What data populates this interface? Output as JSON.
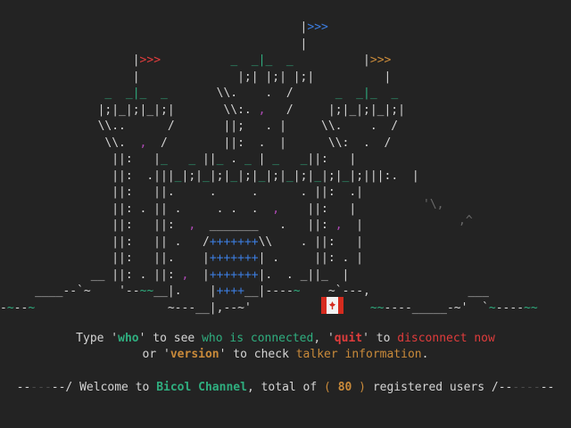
{
  "castle_rows": [
    {
      "segs": [
        [
          "                                           ",
          "w"
        ],
        [
          "|",
          "w"
        ],
        [
          ">>>",
          "b"
        ]
      ]
    },
    {
      "segs": [
        [
          "                                           |",
          "w"
        ]
      ]
    },
    {
      "segs": [
        [
          "                   ",
          "w"
        ],
        [
          "|",
          "w"
        ],
        [
          ">>>",
          "r"
        ],
        [
          "          ",
          "w"
        ],
        [
          "_  _|_  _",
          "g"
        ],
        [
          "          ",
          "w"
        ],
        [
          "|",
          "w"
        ],
        [
          ">>>",
          "o"
        ]
      ]
    },
    {
      "segs": [
        [
          "                   |              |;| |;| |;|          |",
          "w"
        ]
      ]
    },
    {
      "segs": [
        [
          "               ",
          "w"
        ],
        [
          "_  _|_  _",
          "g"
        ],
        [
          "       \\\\.    .  /      ",
          "w"
        ],
        [
          "_  _|_  _",
          "g"
        ]
      ]
    },
    {
      "segs": [
        [
          "              |;|_|;|_|;|       \\\\:. ",
          "w"
        ],
        [
          ",",
          "p"
        ],
        [
          "   /     |;|_|;|_|;|",
          "w"
        ]
      ]
    },
    {
      "segs": [
        [
          "              \\\\..      /       ||;   . |     \\\\.    .  /",
          "w"
        ]
      ]
    },
    {
      "segs": [
        [
          "               \\\\.  ",
          "w"
        ],
        [
          ",",
          "p"
        ],
        [
          "  /        ||:  .  |      \\\\:  .  /",
          "w"
        ]
      ]
    },
    {
      "segs": [
        [
          "                ||:   |",
          "w"
        ],
        [
          "_",
          "g"
        ],
        [
          "   ",
          "w"
        ],
        [
          "_",
          "g"
        ],
        [
          " ||",
          "w"
        ],
        [
          "_",
          "g"
        ],
        [
          " . ",
          "w"
        ],
        [
          "_",
          "g"
        ],
        [
          " | ",
          "w"
        ],
        [
          "_",
          "g"
        ],
        [
          "   ",
          "w"
        ],
        [
          "_",
          "g"
        ],
        [
          "||:   |",
          "w"
        ]
      ]
    },
    {
      "segs": [
        [
          "                ||:  .|||",
          "w"
        ],
        [
          "_",
          "g"
        ],
        [
          "|;|",
          "w"
        ],
        [
          "_",
          "g"
        ],
        [
          "|;|",
          "w"
        ],
        [
          "_",
          "g"
        ],
        [
          "|;|",
          "w"
        ],
        [
          "_",
          "g"
        ],
        [
          "|;|",
          "w"
        ],
        [
          "_",
          "g"
        ],
        [
          "|;|",
          "w"
        ],
        [
          "_",
          "g"
        ],
        [
          "|;|",
          "w"
        ],
        [
          "_",
          "g"
        ],
        [
          "|;|||:.  |",
          "w"
        ]
      ]
    },
    {
      "segs": [
        [
          "                ||:   ||.     .     .      . ||:  .|",
          "w"
        ]
      ]
    },
    {
      "segs": [
        [
          "                ||: . || .     . .  .  ",
          "w"
        ],
        [
          ",",
          "p"
        ],
        [
          "    ||:   |",
          "w"
        ]
      ]
    },
    {
      "segs": [
        [
          "                ||:   ||:  ",
          "w"
        ],
        [
          ",",
          "p"
        ],
        [
          "  _______   .   ||: ",
          "w"
        ],
        [
          ",",
          "p"
        ],
        [
          "  |",
          "w"
        ]
      ]
    },
    {
      "segs": [
        [
          "                ||:   || .   /",
          "w"
        ],
        [
          "+++++++",
          "b"
        ],
        [
          "\\\\    . ||:   |",
          "w"
        ]
      ]
    },
    {
      "segs": [
        [
          "                ||:   ||.    |",
          "w"
        ],
        [
          "+++++++",
          "b"
        ],
        [
          "| .     ||: . |",
          "w"
        ]
      ]
    },
    {
      "segs": [
        [
          "             __ ||: . ||: ",
          "w"
        ],
        [
          ",",
          "p"
        ],
        [
          "  |",
          "w"
        ],
        [
          "+++++++",
          "b"
        ],
        [
          "|.  . _||_  |",
          "w"
        ]
      ]
    },
    {
      "segs": [
        [
          "     ",
          "w"
        ],
        [
          "____--`~",
          "w"
        ],
        [
          "    '--",
          "w"
        ],
        [
          "~~",
          "g"
        ],
        [
          "__|.    |",
          "w"
        ],
        [
          "++++",
          "b"
        ],
        [
          "__",
          "w"
        ],
        [
          "|",
          "w"
        ],
        [
          "----",
          "w"
        ],
        [
          "~",
          "g"
        ],
        [
          "    ~",
          "w"
        ],
        [
          "`---,",
          "w"
        ],
        [
          "              ___",
          "w"
        ]
      ]
    },
    {
      "segs": [
        [
          "-",
          "w"
        ],
        [
          "~",
          "g"
        ],
        [
          "--",
          "w"
        ],
        [
          "~",
          "g"
        ],
        [
          "                   ~---__|,--~'",
          "w"
        ],
        [
          "                 ",
          "w"
        ],
        [
          "~~",
          "g"
        ],
        [
          "----_____-~'",
          "w"
        ],
        [
          "  `",
          "w"
        ],
        [
          "~",
          "g"
        ],
        [
          "----",
          "w"
        ],
        [
          "~~",
          "g"
        ]
      ]
    }
  ],
  "help": {
    "line1_pre": "Type '",
    "line1_who": "who",
    "line1_mid1": "' to see ",
    "line1_who_desc": "who is connected",
    "line1_mid2": ", '",
    "line1_quit": "quit",
    "line1_mid3": "' to ",
    "line1_quit_desc": "disconnect now",
    "line2_pre": "or '",
    "line2_version": "version",
    "line2_mid": "' to check ",
    "line2_version_desc": "talker information",
    "line2_end": "."
  },
  "welcome": {
    "dash_left": "--",
    "dash_left_dim": "---",
    "dash_left2": "--/",
    "pre": " Welcome to ",
    "channel": "Bicol Channel",
    "mid": ", total of ",
    "paren_open": "( ",
    "count": "80",
    "paren_close": " )",
    "post": " registered users ",
    "dash_right": "/--",
    "dash_right_dim": "----",
    "dash_right2": "--"
  },
  "colors": {
    "background": "#232323",
    "green": "#2fae7f",
    "red": "#e03c3c",
    "orange": "#c98a3a",
    "blue": "#3c7de0",
    "flag_red": "#d52b1e"
  }
}
